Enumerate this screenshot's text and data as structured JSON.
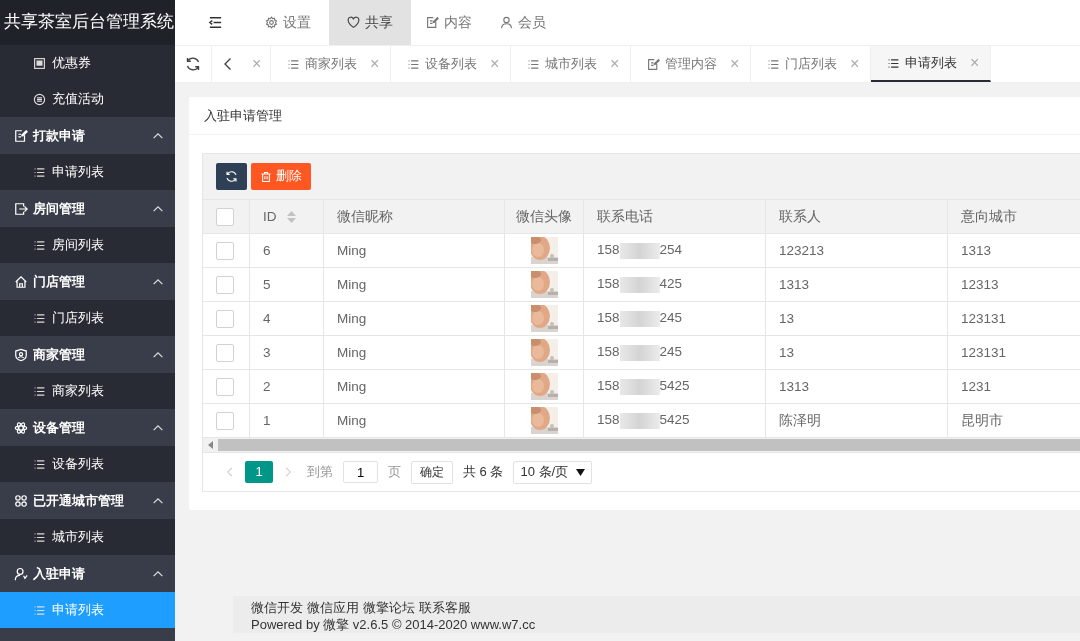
{
  "sidebar": {
    "title": "共享茶室后台管理系统",
    "items": [
      {
        "kind": "link",
        "label": "优惠券",
        "selected": false
      },
      {
        "kind": "link",
        "label": "充值活动",
        "selected": false
      },
      {
        "kind": "group",
        "label": "打款申请",
        "expanded": true,
        "children": [
          {
            "label": "申请列表",
            "selected": false
          }
        ]
      },
      {
        "kind": "group",
        "label": "房间管理",
        "expanded": true,
        "children": [
          {
            "label": "房间列表",
            "selected": false
          }
        ]
      },
      {
        "kind": "group",
        "label": "门店管理",
        "expanded": true,
        "children": [
          {
            "label": "门店列表",
            "selected": false
          }
        ]
      },
      {
        "kind": "group",
        "label": "商家管理",
        "expanded": true,
        "children": [
          {
            "label": "商家列表",
            "selected": false
          }
        ]
      },
      {
        "kind": "group",
        "label": "设备管理",
        "expanded": true,
        "children": [
          {
            "label": "设备列表",
            "selected": false
          }
        ]
      },
      {
        "kind": "group",
        "label": "已开通城市管理",
        "expanded": true,
        "children": [
          {
            "label": "城市列表",
            "selected": false
          }
        ]
      },
      {
        "kind": "group",
        "label": "入驻申请",
        "expanded": true,
        "children": [
          {
            "label": "申请列表",
            "selected": true
          }
        ]
      }
    ]
  },
  "top_nav": {
    "items": [
      {
        "label": "设置",
        "selected": false
      },
      {
        "label": "共享",
        "selected": true
      },
      {
        "label": "内容",
        "selected": false
      },
      {
        "label": "会员",
        "selected": false
      }
    ]
  },
  "tab_bar": {
    "tabs": [
      {
        "kind": "cut",
        "close": "×",
        "selected": false
      },
      {
        "kind": "full",
        "label": "商家列表",
        "close": "×",
        "selected": false
      },
      {
        "kind": "full",
        "label": "设备列表",
        "close": "×",
        "selected": false
      },
      {
        "kind": "full",
        "label": "城市列表",
        "close": "×",
        "selected": false
      },
      {
        "kind": "full",
        "label": "管理内容",
        "close": "×",
        "selected": false
      },
      {
        "kind": "full",
        "label": "门店列表",
        "close": "×",
        "selected": false
      },
      {
        "kind": "full",
        "label": "申请列表",
        "close": "×",
        "selected": true
      }
    ]
  },
  "card": {
    "title": "入驻申请管理",
    "toolbar": {
      "delete_label": "删除"
    },
    "table": {
      "all_checked": false,
      "columns": [
        {
          "label": "ID",
          "kind": "text",
          "sortable": true
        },
        {
          "label": "微信昵称",
          "kind": "text",
          "sortable": false
        },
        {
          "label": "微信头像",
          "sortable": false
        },
        {
          "label": "联系电话",
          "kind": "text",
          "sortable": false
        },
        {
          "label": "联系人",
          "kind": "text",
          "sortable": false
        },
        {
          "label": "意向城市",
          "kind": "text",
          "sortable": false
        }
      ],
      "rows": [
        {
          "checked": false,
          "id": "6",
          "nickname": "Ming",
          "phone_start": "158",
          "phone_end": "254",
          "contact": "123213",
          "city": "1313"
        },
        {
          "checked": false,
          "id": "5",
          "nickname": "Ming",
          "phone_start": "158",
          "phone_end": "425",
          "contact": "1313",
          "city": "12313"
        },
        {
          "checked": false,
          "id": "4",
          "nickname": "Ming",
          "phone_start": "158",
          "phone_end": "245",
          "contact": "13",
          "city": "123131"
        },
        {
          "checked": false,
          "id": "3",
          "nickname": "Ming",
          "phone_start": "158",
          "phone_end": "245",
          "contact": "13",
          "city": "123131"
        },
        {
          "checked": false,
          "id": "2",
          "nickname": "Ming",
          "phone_start": "158",
          "phone_end": "5425",
          "contact": "1313",
          "city": "1231"
        },
        {
          "checked": false,
          "id": "1",
          "nickname": "Ming",
          "phone_start": "158",
          "phone_end": "5425",
          "contact": "陈泽明",
          "city": "昆明市"
        }
      ]
    },
    "pagination": {
      "pages": [
        {
          "label": "1",
          "selected": true
        }
      ],
      "goto_label": "到第",
      "goto_value": "1",
      "page_unit": "页",
      "confirm": "确定",
      "total": "共 6 条",
      "page_size": "10 条/页"
    }
  },
  "footer": {
    "links": [
      "微信开发",
      "微信应用",
      "微擎论坛",
      "联系客服"
    ],
    "powered": "Powered by 微擎 v2.6.5 © 2014-2020 www.w7.cc"
  }
}
